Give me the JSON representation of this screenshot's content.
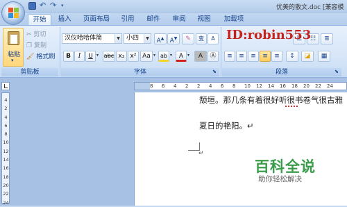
{
  "titlebar": {
    "doc_title": "优美的散文.doc [兼容模"
  },
  "tabs": [
    "开始",
    "插入",
    "页面布局",
    "引用",
    "邮件",
    "审阅",
    "视图",
    "加载项"
  ],
  "clipboard": {
    "paste": "粘贴",
    "cut": "剪切",
    "copy": "复制",
    "format_painter": "格式刷",
    "group_label": "剪贴板"
  },
  "font": {
    "name": "汉仪哈哈体简",
    "size": "小四",
    "group_label": "字体",
    "grow": "A",
    "shrink": "A",
    "clear": "",
    "wen": "变",
    "bold": "B",
    "italic": "I",
    "underline": "U",
    "strike": "abc",
    "sub": "x₂",
    "sup": "x²",
    "case": "Aa",
    "highlight": "ab",
    "color": "A",
    "char_shade": "A"
  },
  "paragraph": {
    "group_label": "段落"
  },
  "watermark": "ID:robin553",
  "document": {
    "line1": "颓垣。那几条有着很好听很书卷气很古雅",
    "line2": "夏日的艳阳。↵"
  },
  "vruler_marks": [
    "4",
    "2",
    "4",
    "6",
    "8",
    "10",
    "12",
    "14",
    "16",
    "18",
    "20",
    "22",
    "24"
  ],
  "hruler_marks": [
    "8",
    "6",
    "4",
    "2",
    "2",
    "4",
    "6",
    "8",
    "10",
    "12",
    "14",
    "16",
    "18",
    "20",
    "22",
    "24"
  ],
  "overlay": {
    "title": "百科全说",
    "subtitle": "助你轻松解决"
  },
  "colors": {
    "accent": "#15428b",
    "highlight": "#f2d629",
    "font_color": "#d41f1f",
    "brand_green": "#3a9d4a"
  }
}
